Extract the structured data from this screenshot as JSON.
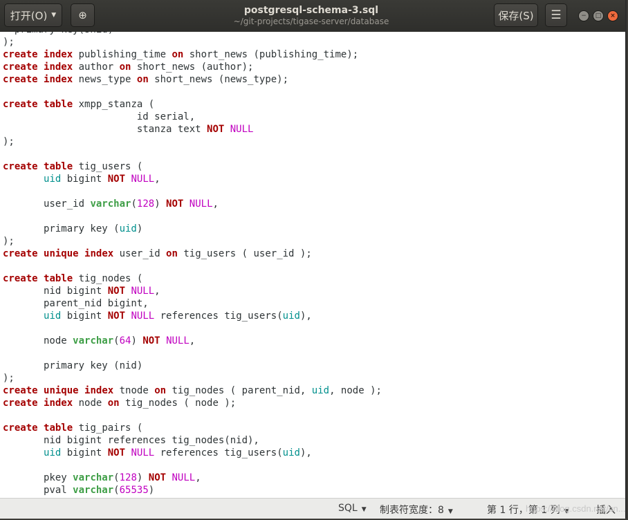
{
  "titlebar": {
    "open_label": "打开(O)",
    "open_arrow": "▼",
    "newtab_icon": "⊕",
    "title": "postgresql-schema-3.sql",
    "subtitle": "~/git-projects/tigase-server/database",
    "save_label": "保存(S)",
    "menu_icon": "☰",
    "min_icon": "−",
    "max_icon": "□",
    "close_icon": "×"
  },
  "code_lines": [
    [
      [
        "pl",
        "  primary key(snid)"
      ]
    ],
    [
      [
        "pl",
        ");"
      ]
    ],
    [
      [
        "kw",
        "create"
      ],
      [
        "pl",
        " "
      ],
      [
        "kw",
        "index"
      ],
      [
        "pl",
        " publishing_time "
      ],
      [
        "kw",
        "on"
      ],
      [
        "pl",
        " short_news (publishing_time);"
      ]
    ],
    [
      [
        "kw",
        "create"
      ],
      [
        "pl",
        " "
      ],
      [
        "kw",
        "index"
      ],
      [
        "pl",
        " author "
      ],
      [
        "kw",
        "on"
      ],
      [
        "pl",
        " short_news (author);"
      ]
    ],
    [
      [
        "kw",
        "create"
      ],
      [
        "pl",
        " "
      ],
      [
        "kw",
        "index"
      ],
      [
        "pl",
        " news_type "
      ],
      [
        "kw",
        "on"
      ],
      [
        "pl",
        " short_news (news_type);"
      ]
    ],
    [
      [
        "pl",
        ""
      ]
    ],
    [
      [
        "kw",
        "create"
      ],
      [
        "pl",
        " "
      ],
      [
        "kw",
        "table"
      ],
      [
        "pl",
        " xmpp_stanza ("
      ]
    ],
    [
      [
        "pl",
        "                       id serial,"
      ]
    ],
    [
      [
        "pl",
        "                       stanza text "
      ],
      [
        "kw",
        "NOT"
      ],
      [
        "pl",
        " "
      ],
      [
        "nl",
        "NULL"
      ]
    ],
    [
      [
        "pl",
        ");"
      ]
    ],
    [
      [
        "pl",
        ""
      ]
    ],
    [
      [
        "kw",
        "create"
      ],
      [
        "pl",
        " "
      ],
      [
        "kw",
        "table"
      ],
      [
        "pl",
        " tig_users ("
      ]
    ],
    [
      [
        "pl",
        "       "
      ],
      [
        "id",
        "uid"
      ],
      [
        "pl",
        " bigint "
      ],
      [
        "kw",
        "NOT"
      ],
      [
        "pl",
        " "
      ],
      [
        "nl",
        "NULL"
      ],
      [
        "pl",
        ","
      ]
    ],
    [
      [
        "pl",
        ""
      ]
    ],
    [
      [
        "pl",
        "       user_id "
      ],
      [
        "ty",
        "varchar"
      ],
      [
        "pl",
        "("
      ],
      [
        "nm",
        "128"
      ],
      [
        "pl",
        ") "
      ],
      [
        "kw",
        "NOT"
      ],
      [
        "pl",
        " "
      ],
      [
        "nl",
        "NULL"
      ],
      [
        "pl",
        ","
      ]
    ],
    [
      [
        "pl",
        ""
      ]
    ],
    [
      [
        "pl",
        "       primary key ("
      ],
      [
        "id",
        "uid"
      ],
      [
        "pl",
        ")"
      ]
    ],
    [
      [
        "pl",
        ");"
      ]
    ],
    [
      [
        "kw",
        "create"
      ],
      [
        "pl",
        " "
      ],
      [
        "kw",
        "unique"
      ],
      [
        "pl",
        " "
      ],
      [
        "kw",
        "index"
      ],
      [
        "pl",
        " user_id "
      ],
      [
        "kw",
        "on"
      ],
      [
        "pl",
        " tig_users ( user_id );"
      ]
    ],
    [
      [
        "pl",
        ""
      ]
    ],
    [
      [
        "kw",
        "create"
      ],
      [
        "pl",
        " "
      ],
      [
        "kw",
        "table"
      ],
      [
        "pl",
        " tig_nodes ("
      ]
    ],
    [
      [
        "pl",
        "       nid bigint "
      ],
      [
        "kw",
        "NOT"
      ],
      [
        "pl",
        " "
      ],
      [
        "nl",
        "NULL"
      ],
      [
        "pl",
        ","
      ]
    ],
    [
      [
        "pl",
        "       parent_nid bigint,"
      ]
    ],
    [
      [
        "pl",
        "       "
      ],
      [
        "id",
        "uid"
      ],
      [
        "pl",
        " bigint "
      ],
      [
        "kw",
        "NOT"
      ],
      [
        "pl",
        " "
      ],
      [
        "nl",
        "NULL"
      ],
      [
        "pl",
        " references tig_users("
      ],
      [
        "id",
        "uid"
      ],
      [
        "pl",
        "),"
      ]
    ],
    [
      [
        "pl",
        ""
      ]
    ],
    [
      [
        "pl",
        "       node "
      ],
      [
        "ty",
        "varchar"
      ],
      [
        "pl",
        "("
      ],
      [
        "nm",
        "64"
      ],
      [
        "pl",
        ") "
      ],
      [
        "kw",
        "NOT"
      ],
      [
        "pl",
        " "
      ],
      [
        "nl",
        "NULL"
      ],
      [
        "pl",
        ","
      ]
    ],
    [
      [
        "pl",
        ""
      ]
    ],
    [
      [
        "pl",
        "       primary key (nid)"
      ]
    ],
    [
      [
        "pl",
        ");"
      ]
    ],
    [
      [
        "kw",
        "create"
      ],
      [
        "pl",
        " "
      ],
      [
        "kw",
        "unique"
      ],
      [
        "pl",
        " "
      ],
      [
        "kw",
        "index"
      ],
      [
        "pl",
        " tnode "
      ],
      [
        "kw",
        "on"
      ],
      [
        "pl",
        " tig_nodes ( parent_nid, "
      ],
      [
        "id",
        "uid"
      ],
      [
        "pl",
        ", node );"
      ]
    ],
    [
      [
        "kw",
        "create"
      ],
      [
        "pl",
        " "
      ],
      [
        "kw",
        "index"
      ],
      [
        "pl",
        " node "
      ],
      [
        "kw",
        "on"
      ],
      [
        "pl",
        " tig_nodes ( node );"
      ]
    ],
    [
      [
        "pl",
        ""
      ]
    ],
    [
      [
        "kw",
        "create"
      ],
      [
        "pl",
        " "
      ],
      [
        "kw",
        "table"
      ],
      [
        "pl",
        " tig_pairs ("
      ]
    ],
    [
      [
        "pl",
        "       nid bigint references tig_nodes(nid),"
      ]
    ],
    [
      [
        "pl",
        "       "
      ],
      [
        "id",
        "uid"
      ],
      [
        "pl",
        " bigint "
      ],
      [
        "kw",
        "NOT"
      ],
      [
        "pl",
        " "
      ],
      [
        "nl",
        "NULL"
      ],
      [
        "pl",
        " references tig_users("
      ],
      [
        "id",
        "uid"
      ],
      [
        "pl",
        "),"
      ]
    ],
    [
      [
        "pl",
        ""
      ]
    ],
    [
      [
        "pl",
        "       pkey "
      ],
      [
        "ty",
        "varchar"
      ],
      [
        "pl",
        "("
      ],
      [
        "nm",
        "128"
      ],
      [
        "pl",
        ") "
      ],
      [
        "kw",
        "NOT"
      ],
      [
        "pl",
        " "
      ],
      [
        "nl",
        "NULL"
      ],
      [
        "pl",
        ","
      ]
    ],
    [
      [
        "pl",
        "       pval "
      ],
      [
        "ty",
        "varchar"
      ],
      [
        "pl",
        "("
      ],
      [
        "nm",
        "65535"
      ],
      [
        "pl",
        ")"
      ]
    ]
  ],
  "statusbar": {
    "language": "SQL",
    "tab_width": "制表符宽度：8",
    "position": "第 1 行，第 1 列",
    "mode": "插入",
    "arrow": "▼"
  },
  "watermark": "https://blog.csdn.net/cn..."
}
